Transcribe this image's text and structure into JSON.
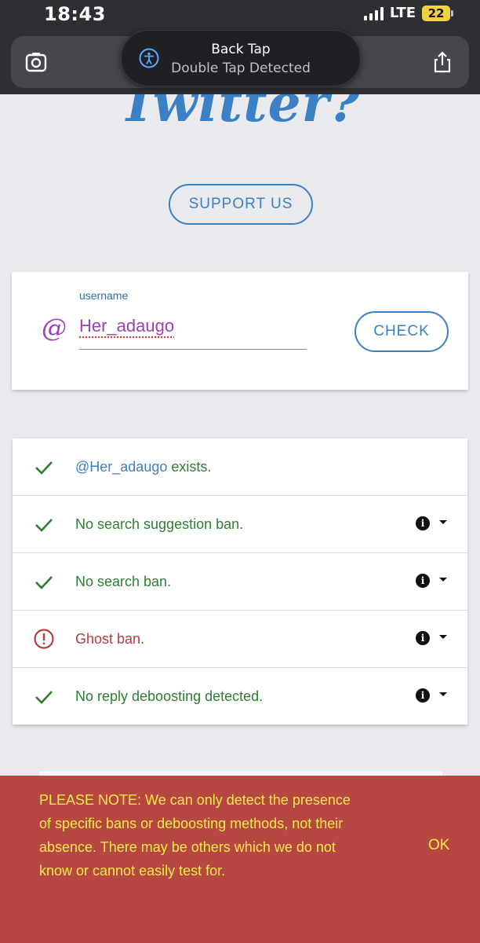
{
  "status_bar": {
    "time": "18:43",
    "network": "LTE",
    "battery": "22"
  },
  "hud": {
    "title": "Back Tap",
    "subtitle": "Double Tap Detected"
  },
  "page": {
    "hero_title": "Twitter?",
    "support_button": "SUPPORT US"
  },
  "search": {
    "label": "username",
    "prefix": "@",
    "value": "Her_adaugo",
    "check_button": "CHECK"
  },
  "results": [
    {
      "handle": "@Her_adaugo",
      "text": " exists.",
      "status": "ok",
      "info": false
    },
    {
      "handle": "",
      "text": "No search suggestion ban.",
      "status": "ok",
      "info": true
    },
    {
      "handle": "",
      "text": "No search ban.",
      "status": "ok",
      "info": true
    },
    {
      "handle": "",
      "text": "Ghost ban.",
      "status": "bad",
      "info": true
    },
    {
      "handle": "",
      "text": "No reply deboosting detected.",
      "status": "ok",
      "info": true
    }
  ],
  "notice": {
    "text": "PLEASE NOTE: We can only detect the presence of specific bans or deboosting methods, not their absence. There may be others which we do not know or cannot easily test for.",
    "ok_label": "OK"
  },
  "colors": {
    "accent": "#3b7fc4",
    "ok": "#2e7d32",
    "bad": "#b33d3a",
    "notice_bg": "#b74741",
    "notice_text": "#f6e84d"
  }
}
